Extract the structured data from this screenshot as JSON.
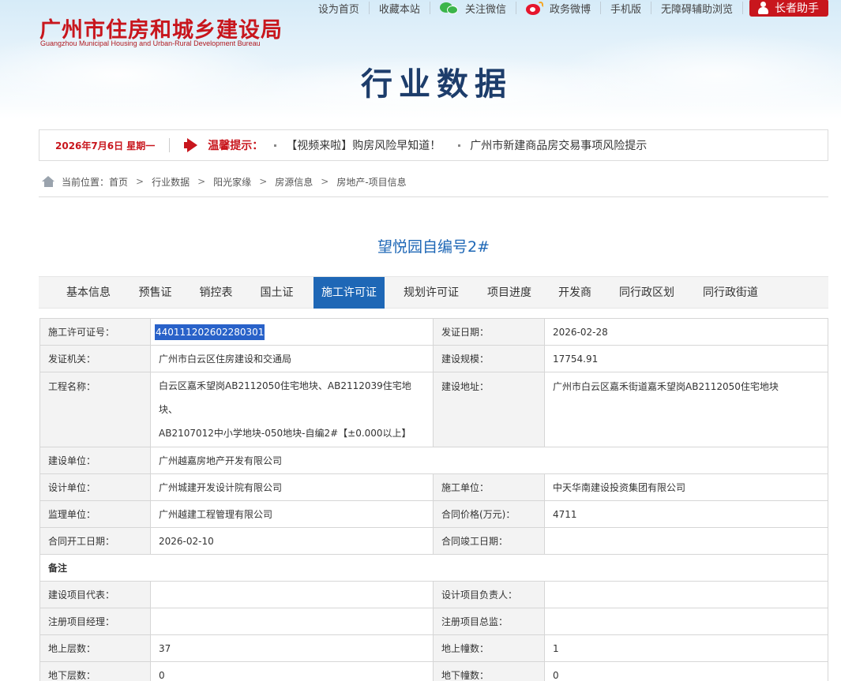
{
  "header": {
    "org_name_cn": "广州市住房和城乡建设局",
    "org_name_en": "Guangzhou Municipal Housing and Urban-Rural Development Bureau",
    "page_title": "行业数据",
    "top_links": [
      "设为首页",
      "收藏本站",
      "关注微信",
      "政务微博",
      "手机版",
      "无障碍辅助浏览"
    ],
    "elder_button": "长者助手"
  },
  "notice": {
    "date": "2026年7月6日 星期一",
    "tip_label": "温馨提示：",
    "items": [
      "【视频来啦】购房风险早知道！",
      "广州市新建商品房交易事项风险提示"
    ]
  },
  "breadcrumb": {
    "prefix": "当前位置：",
    "items": [
      "首页",
      "行业数据",
      "阳光家缘",
      "房源信息",
      "房地产-项目信息"
    ],
    "separator": ">"
  },
  "project_title": "望悦园自编号2#",
  "tabs": [
    "基本信息",
    "预售证",
    "销控表",
    "国土证",
    "施工许可证",
    "规划许可证",
    "项目进度",
    "开发商",
    "同行政区划",
    "同行政街道"
  ],
  "active_tab": "施工许可证",
  "permit": {
    "permit_no_label": "施工许可证号：",
    "permit_no": "440111202602280301",
    "issue_date_label": "发证日期：",
    "issue_date": "2026-02-28",
    "issuer_label": "发证机关：",
    "issuer": "广州市白云区住房建设和交通局",
    "scale_label": "建设规模：",
    "scale": "17754.91",
    "project_name_label": "工程名称：",
    "project_name_line1": "白云区嘉禾望岗AB2112050住宅地块、AB2112039住宅地块、",
    "project_name_line2": "AB2107012中小学地块-050地块-自编2#【±0.000以上】",
    "address_label": "建设地址：",
    "address": "广州市白云区嘉禾街道嘉禾望岗AB2112050住宅地块",
    "builder_label": "建设单位：",
    "builder": "广州越嘉房地产开发有限公司",
    "designer_label": "设计单位：",
    "designer": "广州城建开发设计院有限公司",
    "constructor_label": "施工单位：",
    "constructor": "中天华南建设投资集团有限公司",
    "supervisor_label": "监理单位：",
    "supervisor": "广州越建工程管理有限公司",
    "contract_price_label": "合同价格(万元)：",
    "contract_price": "4711",
    "start_date_label": "合同开工日期：",
    "start_date": "2026-02-10",
    "end_date_label": "合同竣工日期：",
    "end_date": "",
    "remark_label": "备注",
    "rep_label": "建设项目代表：",
    "rep": "",
    "design_lead_label": "设计项目负责人：",
    "design_lead": "",
    "pm_label": "注册项目经理：",
    "pm": "",
    "chief_sup_label": "注册项目总监：",
    "chief_sup": "",
    "floors_above_label": "地上层数：",
    "floors_above": "37",
    "bldg_above_label": "地上幢数：",
    "bldg_above": "1",
    "floors_below_label": "地下层数：",
    "floors_below": "0",
    "bldg_below_label": "地下幢数：",
    "bldg_below": "0"
  },
  "colors": {
    "brand_red": "#c8161d",
    "tab_active": "#1e67b6",
    "selection": "#2962c9"
  }
}
